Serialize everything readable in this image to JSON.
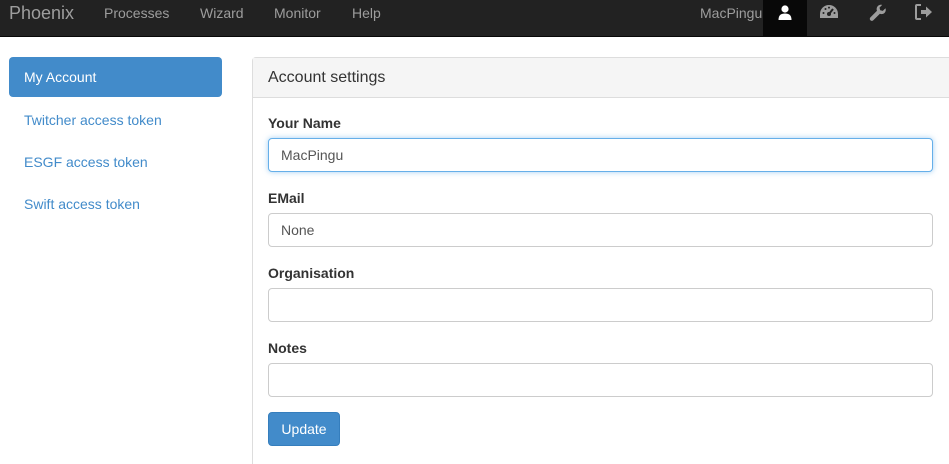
{
  "navbar": {
    "brand": "Phoenix",
    "links": [
      {
        "label": "Processes"
      },
      {
        "label": "Wizard"
      },
      {
        "label": "Monitor"
      },
      {
        "label": "Help"
      }
    ],
    "username": "MacPingu",
    "icons": [
      {
        "name": "user-icon",
        "active": true
      },
      {
        "name": "dashboard-icon",
        "active": false
      },
      {
        "name": "wrench-icon",
        "active": false
      },
      {
        "name": "logout-icon",
        "active": false
      }
    ]
  },
  "sidebar": {
    "items": [
      {
        "label": "My Account",
        "active": true
      },
      {
        "label": "Twitcher access token",
        "active": false
      },
      {
        "label": "ESGF access token",
        "active": false
      },
      {
        "label": "Swift access token",
        "active": false
      }
    ]
  },
  "panel": {
    "title": "Account settings",
    "fields": [
      {
        "label": "Your Name",
        "value": "MacPingu"
      },
      {
        "label": "EMail",
        "value": "None"
      },
      {
        "label": "Organisation",
        "value": ""
      },
      {
        "label": "Notes",
        "value": ""
      }
    ],
    "submit_label": "Update"
  },
  "colors": {
    "navbar_bg": "#222222",
    "accent": "#428bca",
    "link": "#428bca"
  }
}
